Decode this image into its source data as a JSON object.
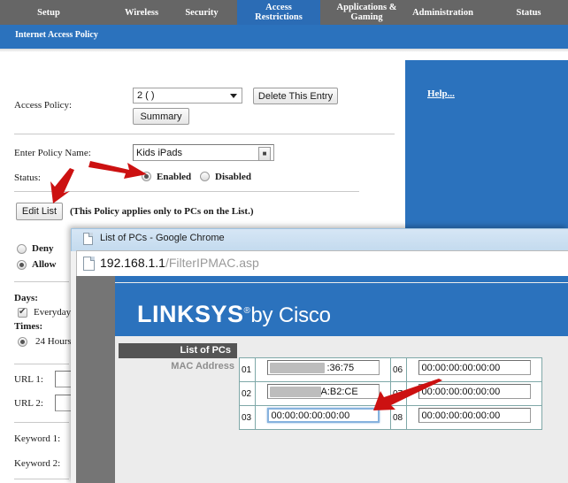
{
  "router": {
    "nav_tabs": [
      {
        "label": "Setup",
        "active": false
      },
      {
        "label": "Wireless",
        "active": false
      },
      {
        "label": "Security",
        "active": false
      },
      {
        "label": "Access\nRestrictions",
        "active": true
      },
      {
        "label": "Applications &\nGaming",
        "active": false
      },
      {
        "label": "Administration",
        "active": false
      },
      {
        "label": "Status",
        "active": false
      }
    ],
    "sub_title": "Internet Access Policy",
    "help_link": "Help...",
    "form": {
      "access_policy_label": "Access Policy:",
      "access_policy_value": "2 ( )",
      "delete_button": "Delete This Entry",
      "summary_button": "Summary",
      "policy_name_label": "Enter Policy Name:",
      "policy_name_value": "Kids iPads",
      "status_label": "Status:",
      "status_enabled": "Enabled",
      "status_disabled": "Disabled",
      "status_selected": "Enabled",
      "edit_list_button": "Edit List",
      "edit_list_note": "(This Policy applies only to PCs on the List.)",
      "deny_label": "Deny",
      "allow_label": "Allow",
      "access_selected": "Allow",
      "days_label": "Days:",
      "everyday_label": "Everyday",
      "everyday_checked": true,
      "times_label": "Times:",
      "hours_label": "24 Hours",
      "url1_label": "URL 1:",
      "url1_value": "",
      "url2_label": "URL 2:",
      "url2_value": "",
      "keyword1_label": "Keyword 1:",
      "keyword2_label": "Keyword 2:"
    }
  },
  "popup": {
    "window_title": "List of PCs - Google Chrome",
    "url_host": "192.168.1.1",
    "url_path": "/FilterIPMAC.asp",
    "brand_primary": "LINKSYS",
    "brand_reg": "®",
    "brand_secondary": "by Cisco",
    "section_title": "List of PCs",
    "mac_label": "MAC Address",
    "mac_rows_left": [
      {
        "index": "01",
        "value": ":36:75",
        "redacted": true,
        "redact_width": 62,
        "focused": false
      },
      {
        "index": "02",
        "value": "A:B2:CE",
        "redacted": true,
        "redact_width": 58,
        "focused": false
      },
      {
        "index": "03",
        "value": "00:00:00:00:00:00",
        "redacted": false,
        "redact_width": 0,
        "focused": true
      }
    ],
    "mac_rows_right": [
      {
        "index": "06",
        "value": "00:00:00:00:00:00",
        "redacted": false,
        "redact_width": 0,
        "focused": false
      },
      {
        "index": "07",
        "value": "00:00:00:00:00:00",
        "redacted": false,
        "redact_width": 0,
        "focused": false
      },
      {
        "index": "08",
        "value": "00:00:00:00:00:00",
        "redacted": false,
        "redact_width": 0,
        "focused": false
      }
    ]
  },
  "colors": {
    "nav_bg": "#666666",
    "accent_blue": "#2b72bd",
    "active_tab": "#2b6cb5",
    "annotation_red": "#cc1111",
    "header_gray": "#555555"
  }
}
